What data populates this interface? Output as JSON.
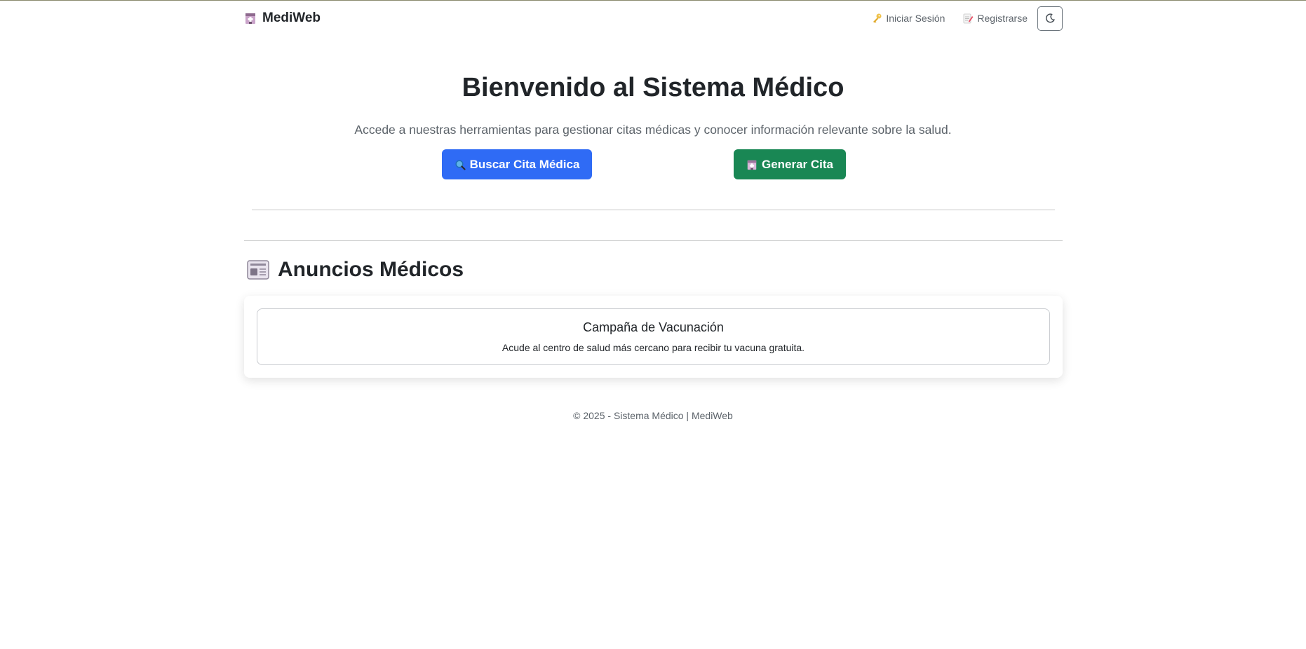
{
  "navbar": {
    "brand": "MediWeb",
    "brand_icon": "hospital-icon",
    "links": [
      {
        "label": "Iniciar Sesión",
        "icon": "key-icon"
      },
      {
        "label": "Registrarse",
        "icon": "memo-icon"
      }
    ],
    "theme_toggle_icon": "moon-icon"
  },
  "hero": {
    "title": "Bienvenido al Sistema Médico",
    "subtitle": "Accede a nuestras herramientas para gestionar citas médicas y conocer información relevante sobre la salud.",
    "buttons": [
      {
        "label": "Buscar Cita Médica",
        "icon": "magnifier-icon",
        "color": "#2f6bf5"
      },
      {
        "label": "Generar Cita",
        "icon": "hospital-icon",
        "color": "#198754"
      }
    ]
  },
  "announcements": {
    "title": "Anuncios Médicos",
    "icon": "newspaper-icon",
    "items": [
      {
        "title": "Campaña de Vacunación",
        "text": "Acude al centro de salud más cercano para recibir tu vacuna gratuita."
      }
    ]
  },
  "footer": {
    "text": "© 2025 - Sistema Médico | MediWeb"
  }
}
